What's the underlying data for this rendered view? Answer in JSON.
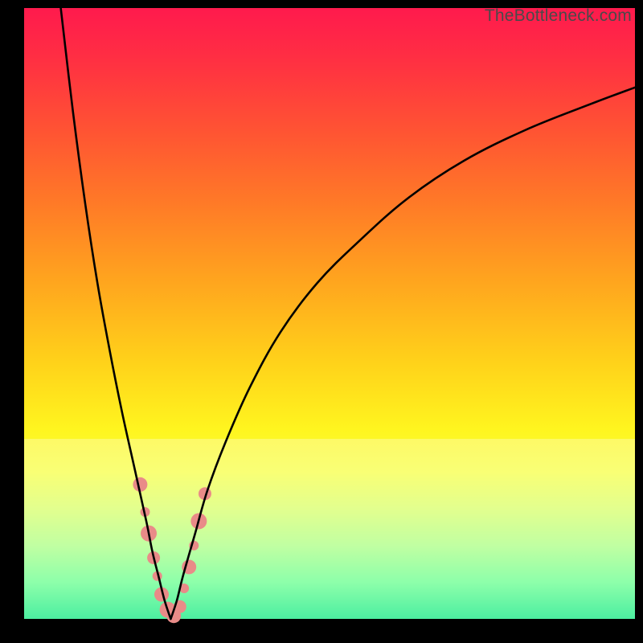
{
  "watermark": "TheBottleneck.com",
  "chart_data": {
    "type": "line",
    "title": "",
    "xlabel": "",
    "ylabel": "",
    "xlim": [
      0,
      100
    ],
    "ylim": [
      0,
      100
    ],
    "grid": false,
    "legend": false,
    "notes": "Bottleneck-style V-curve. Background is a vertical red→green gradient (red = high bottleneck, green = low). Two black curves descend to a sharp minimum near x≈24, y≈0 and rise again. Salmon markers cluster around the trough. Cream/white translucent band behind the lower portion of the curves.",
    "gradient_stops": [
      {
        "pos": 0,
        "color": "#ff1a4d"
      },
      {
        "pos": 20,
        "color": "#ff5333"
      },
      {
        "pos": 45,
        "color": "#ffa61e"
      },
      {
        "pos": 69,
        "color": "#fff51f"
      },
      {
        "pos": 88,
        "color": "#a6ff7a"
      },
      {
        "pos": 100,
        "color": "#00e878"
      }
    ],
    "pale_band": {
      "y_from": 71,
      "y_to": 100
    },
    "series": [
      {
        "name": "left-branch",
        "x": [
          6,
          8,
          10,
          12,
          14,
          16,
          18,
          20,
          21,
          22,
          23,
          24
        ],
        "y": [
          100,
          83,
          68,
          55,
          44,
          34,
          25,
          16,
          11,
          7,
          3,
          0
        ]
      },
      {
        "name": "right-branch",
        "x": [
          24,
          25,
          26,
          28,
          30,
          33,
          37,
          42,
          48,
          55,
          63,
          72,
          82,
          92,
          100
        ],
        "y": [
          0,
          3,
          7,
          14,
          21,
          29,
          38,
          47,
          55,
          62,
          69,
          75,
          80,
          84,
          87
        ]
      }
    ],
    "markers": {
      "color": "#e98b88",
      "radius_major": 10,
      "radius_minor": 6,
      "points": [
        {
          "x": 19.0,
          "y": 22.0,
          "r": 9
        },
        {
          "x": 19.8,
          "y": 17.5,
          "r": 6
        },
        {
          "x": 20.4,
          "y": 14.0,
          "r": 10
        },
        {
          "x": 21.2,
          "y": 10.0,
          "r": 8
        },
        {
          "x": 21.8,
          "y": 7.0,
          "r": 6
        },
        {
          "x": 22.5,
          "y": 4.0,
          "r": 9
        },
        {
          "x": 23.5,
          "y": 1.5,
          "r": 10
        },
        {
          "x": 24.5,
          "y": 0.5,
          "r": 9
        },
        {
          "x": 25.5,
          "y": 2.0,
          "r": 8
        },
        {
          "x": 26.2,
          "y": 5.0,
          "r": 6
        },
        {
          "x": 27.0,
          "y": 8.5,
          "r": 9
        },
        {
          "x": 27.8,
          "y": 12.0,
          "r": 6
        },
        {
          "x": 28.6,
          "y": 16.0,
          "r": 10
        },
        {
          "x": 29.6,
          "y": 20.5,
          "r": 8
        }
      ]
    }
  }
}
